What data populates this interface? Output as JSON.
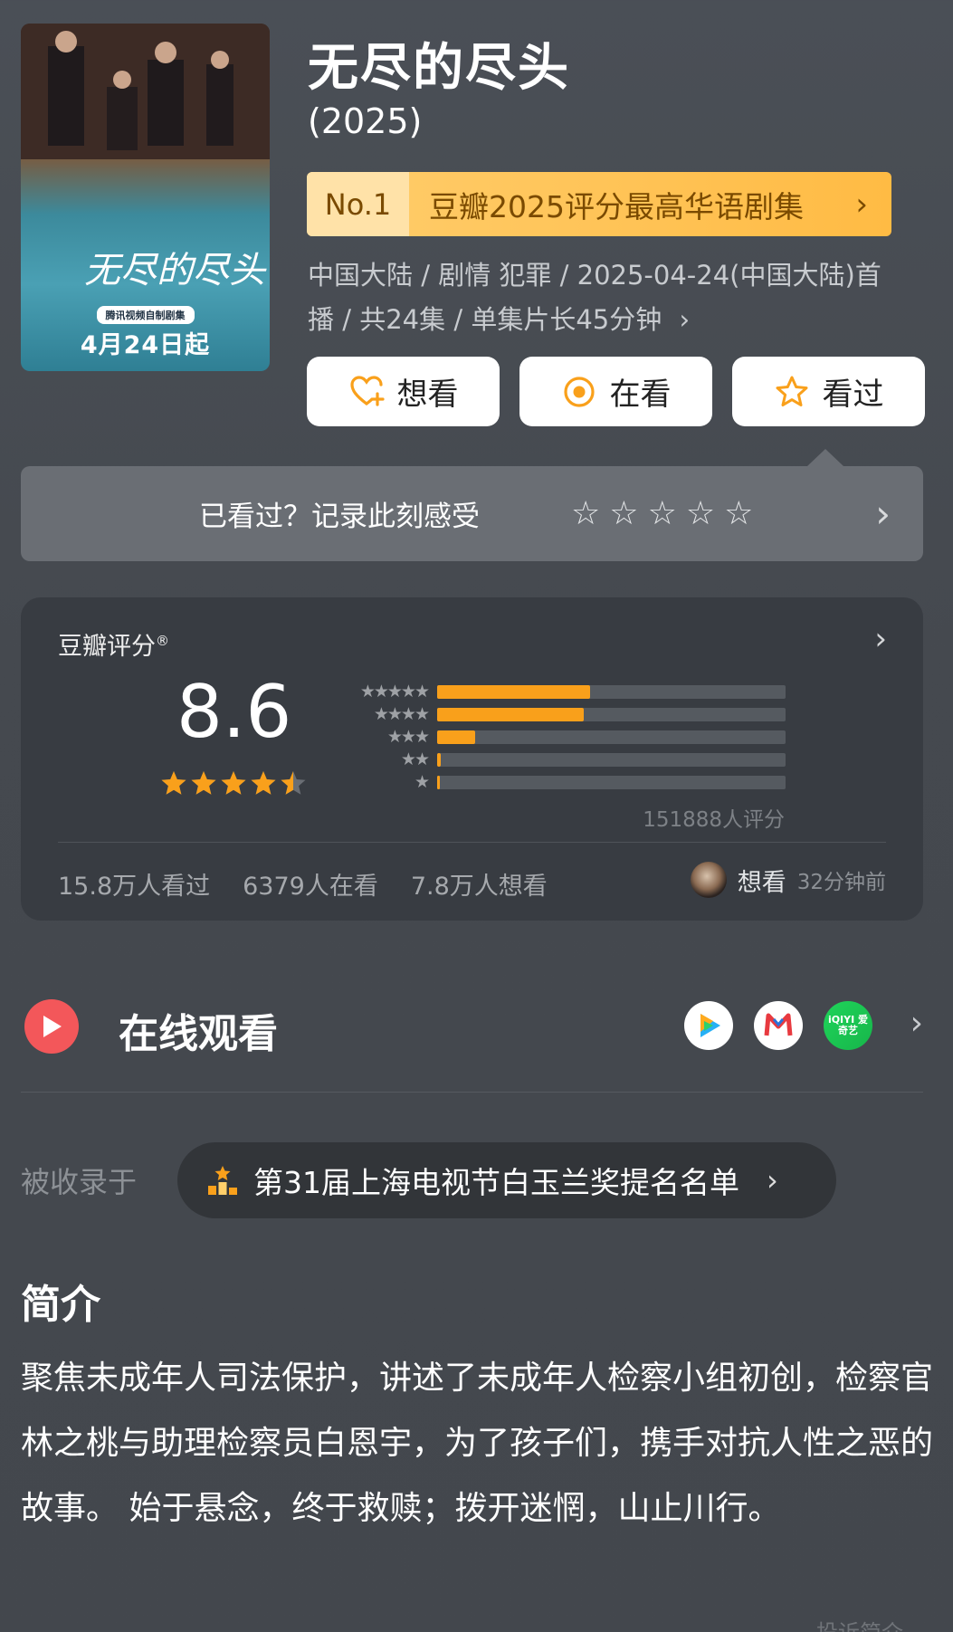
{
  "poster": {
    "date_text": "4月24日起",
    "badge_text": "腾讯视频自制剧集",
    "calligraphy": "无尽的尽头"
  },
  "title": "无尽的尽头",
  "year": "(2025)",
  "rank_banner": {
    "no": "No.1",
    "text": "豆瓣2025评分最高华语剧集",
    "chevron": "›"
  },
  "meta": {
    "line1": "中国大陆 / 剧情 犯罪 / 2025-04-24(中国大陆)首",
    "line2": "播 / 共24集 / 单集片长45分钟",
    "chevron": "›"
  },
  "actions": {
    "want": "想看",
    "watching": "在看",
    "watched": "看过"
  },
  "record": {
    "text": "已看过？记录此刻感受",
    "stars": [
      "☆",
      "☆",
      "☆",
      "☆",
      "☆"
    ],
    "chevron": "›"
  },
  "rating": {
    "label": "豆瓣评分",
    "label_mark": "®",
    "score": "8.6",
    "stars_value": 4.5,
    "distribution": [
      {
        "stars": "★★★★★",
        "fraction": 0.44
      },
      {
        "stars": "★★★★",
        "fraction": 0.42
      },
      {
        "stars": "★★★",
        "fraction": 0.11
      },
      {
        "stars": "★★",
        "fraction": 0.01
      },
      {
        "stars": "★",
        "fraction": 0.005
      }
    ],
    "count": "151888人评分",
    "stats": {
      "watched": "15.8万人看过",
      "watching": "6379人在看",
      "want": "7.8万人想看"
    },
    "activity": {
      "action": "想看",
      "time": "32分钟前"
    },
    "chevron": "›"
  },
  "watch": {
    "title": "在线观看",
    "platform_iqiyi_label": "iQIYI 爱奇艺",
    "chevron": "›"
  },
  "collected": {
    "label": "被收录于",
    "text": "第31届上海电视节白玉兰奖提名名单",
    "chevron": "›"
  },
  "intro": {
    "heading": "简介",
    "body": "聚焦未成年人司法保护，讲述了未成年人检察小组初创，检察官林之桃与助理检察员白恩宇，为了孩子们，携手对抗人性之恶的故事。 始于悬念，终于救赎；拨开迷惘，山止川行。",
    "report": "投诉简介"
  },
  "colors": {
    "accent_orange": "#f9a01b",
    "banner_gold": "#ffbb44",
    "play_red": "#f3575a",
    "card_bg": "#383c42"
  }
}
